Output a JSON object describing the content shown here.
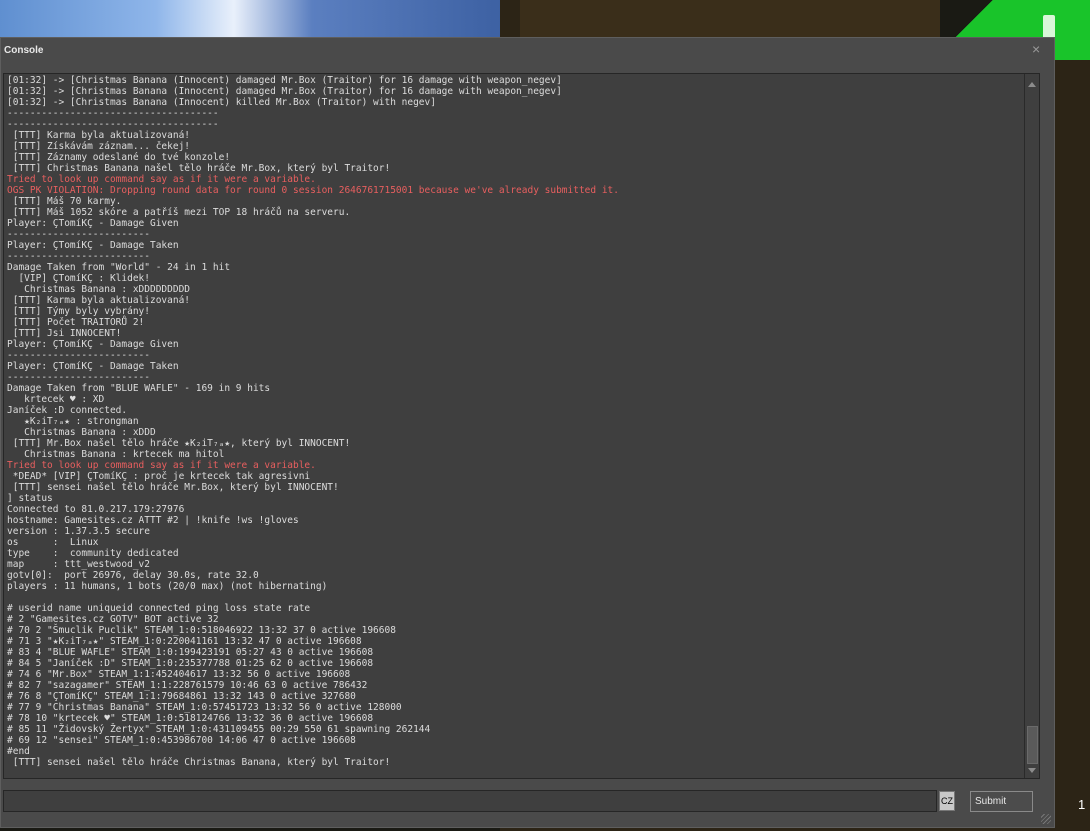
{
  "window": {
    "title": "Console",
    "close_glyph": "×"
  },
  "log": [
    {
      "text": "[01:32] -> [Christmas Banana (Innocent) damaged Mr.Box (Traitor) for 16 damage with weapon_negev]"
    },
    {
      "text": "[01:32] -> [Christmas Banana (Innocent) damaged Mr.Box (Traitor) for 16 damage with weapon_negev]"
    },
    {
      "text": "[01:32] -> [Christmas Banana (Innocent) killed Mr.Box (Traitor) with negev]"
    },
    {
      "text": "-------------------------------------"
    },
    {
      "text": "-------------------------------------"
    },
    {
      "text": " [TTT] Karma byla aktualizovaná!"
    },
    {
      "text": " [TTT] Získávám záznam... čekej!"
    },
    {
      "text": " [TTT] Záznamy odeslané do tvé konzole!"
    },
    {
      "text": " [TTT] Christmas Banana našel tělo hráče Mr.Box, který byl Traitor!"
    },
    {
      "text": "Tried to look up command say as if it were a variable.",
      "red": true
    },
    {
      "text": "OGS PK VIOLATION: Dropping round data for round 0 session 2646761715001 because we've already submitted it.",
      "red": true
    },
    {
      "text": " [TTT] Máš 70 karmy."
    },
    {
      "text": " [TTT] Máš 1052 skóre a patříš mezi TOP 18 hráčů na serveru."
    },
    {
      "text": "Player: ÇTomíKÇ - Damage Given"
    },
    {
      "text": "-------------------------"
    },
    {
      "text": "Player: ÇTomíKÇ - Damage Taken"
    },
    {
      "text": "-------------------------"
    },
    {
      "text": "Damage Taken from \"World\" - 24 in 1 hit"
    },
    {
      "text": "  [VIP] ÇTomíKÇ : Klidek!"
    },
    {
      "text": "   Christmas Banana : xDDDDDDDDD"
    },
    {
      "text": " [TTT] Karma byla aktualizovaná!"
    },
    {
      "text": " [TTT] Týmy byly vybrány!"
    },
    {
      "text": " [TTT] Počet TRAITORŮ 2!"
    },
    {
      "text": " [TTT] Jsi INNOCENT!"
    },
    {
      "text": "Player: ÇTomíKÇ - Damage Given"
    },
    {
      "text": "-------------------------"
    },
    {
      "text": "Player: ÇTomíKÇ - Damage Taken"
    },
    {
      "text": "-------------------------"
    },
    {
      "text": "Damage Taken from \"BLUE WAFLE\" - 169 in 9 hits"
    },
    {
      "text": "   krtecek ♥ : XD"
    },
    {
      "text": "Janíček :D connected."
    },
    {
      "text": "   ★K₂iT₇ₐ★ : strongman"
    },
    {
      "text": "   Christmas Banana : xDDD"
    },
    {
      "text": " [TTT] Mr.Box našel tělo hráče ★K₂iT₇ₐ★, který byl INNOCENT!"
    },
    {
      "text": "   Christmas Banana : krtecek ma hitol"
    },
    {
      "text": "Tried to look up command say as if it were a variable.",
      "red": true
    },
    {
      "text": " *DEAD* [VIP] ÇTomíKÇ : proč je krtecek tak agresivni"
    },
    {
      "text": " [TTT] sensei našel tělo hráče Mr.Box, který byl INNOCENT!"
    },
    {
      "text": "] status"
    },
    {
      "text": "Connected to 81.0.217.179:27976"
    },
    {
      "text": "hostname: Gamesites.cz ATTT #2 | !knife !ws !gloves"
    },
    {
      "text": "version : 1.37.3.5 secure"
    },
    {
      "text": "os      :  Linux"
    },
    {
      "text": "type    :  community dedicated"
    },
    {
      "text": "map     : ttt_westwood_v2"
    },
    {
      "text": "gotv[0]:  port 26976, delay 30.0s, rate 32.0"
    },
    {
      "text": "players : 11 humans, 1 bots (20/0 max) (not hibernating)"
    },
    {
      "text": ""
    },
    {
      "text": "# userid name uniqueid connected ping loss state rate"
    },
    {
      "text": "# 2 \"Gamesites.cz GOTV\" BOT active 32"
    },
    {
      "text": "# 70 2 \"Šmuclik Puclik\" STEAM_1:0:518046922 13:32 37 0 active 196608"
    },
    {
      "text": "# 71 3 \"★K₂iT₇ₐ★\" STEAM_1:0:220041161 13:32 47 0 active 196608"
    },
    {
      "text": "# 83 4 \"BLUE WAFLE\" STEAM_1:0:199423191 05:27 43 0 active 196608"
    },
    {
      "text": "# 84 5 \"Janíček :D\" STEAM_1:0:235377788 01:25 62 0 active 196608"
    },
    {
      "text": "# 74 6 \"Mr.Box\" STEAM_1:1:452404617 13:32 56 0 active 196608"
    },
    {
      "text": "# 82 7 \"sazagamer\" STEAM_1:1:228761579 10:46 63 0 active 786432"
    },
    {
      "text": "# 76 8 \"ÇTomíKÇ\" STEAM_1:1:79684861 13:32 143 0 active 327680"
    },
    {
      "text": "# 77 9 \"Christmas Banana\" STEAM_1:0:57451723 13:32 56 0 active 128000"
    },
    {
      "text": "# 78 10 \"krtecek ♥\" STEAM_1:0:518124766 13:32 36 0 active 196608"
    },
    {
      "text": "# 85 11 \"Židovský Žertyx\" STEAM_1:0:431109455 00:29 550 61 spawning 262144"
    },
    {
      "text": "# 69 12 \"sensei\" STEAM_1:0:453986700 14:06 47 0 active 196608"
    },
    {
      "text": "#end"
    },
    {
      "text": " [TTT] sensei našel tělo hráče Christmas Banana, který byl Traitor!"
    }
  ],
  "input": {
    "value": "",
    "placeholder": "",
    "language_indicator": "CZ"
  },
  "submit_label": "Submit",
  "corner_number": "1"
}
